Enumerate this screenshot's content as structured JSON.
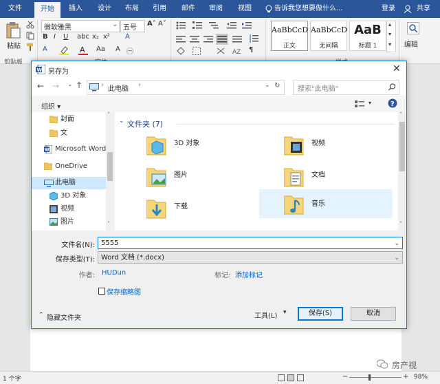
{
  "ribbon": {
    "tabs": [
      "文件",
      "开始",
      "插入",
      "设计",
      "布局",
      "引用",
      "邮件",
      "审阅",
      "视图"
    ],
    "active_tab": "开始",
    "tell_me": "告诉我您想要做什么...",
    "login": "登录",
    "share": "共享",
    "clipboard": {
      "paste": "粘贴",
      "group": "剪贴板"
    },
    "font": {
      "name": "微软雅黑",
      "size": "五号",
      "group": "字体"
    },
    "styles": {
      "items": [
        {
          "preview": "AaBbCcD",
          "name": "正文"
        },
        {
          "preview": "AaBbCcD",
          "name": "无间隔"
        },
        {
          "preview": "AaB",
          "name": "标题 1"
        }
      ],
      "group": "样式"
    },
    "edit": {
      "label": "编辑"
    }
  },
  "dialog": {
    "title": "另存为",
    "breadcrumb": "此电脑",
    "search_placeholder": "搜索\"此电脑\"",
    "organize": "组织 ▾",
    "nav_items": [
      {
        "label": "封面",
        "icon": "folder-icon"
      },
      {
        "label": "文",
        "icon": "folder-icon"
      },
      {
        "label": "Microsoft Word",
        "icon": "word-icon"
      },
      {
        "label": "OneDrive",
        "icon": "folder-icon"
      },
      {
        "label": "此电脑",
        "icon": "computer-icon"
      },
      {
        "label": "3D 对象",
        "icon": "3d-objects-icon"
      },
      {
        "label": "视频",
        "icon": "video-icon"
      },
      {
        "label": "图片",
        "icon": "pictures-icon"
      }
    ],
    "section_header": "文件夹 (7)",
    "folders": [
      {
        "label": "3D 对象",
        "icon": "3d-objects-icon"
      },
      {
        "label": "视频",
        "icon": "video-folder-icon"
      },
      {
        "label": "图片",
        "icon": "pictures-folder-icon"
      },
      {
        "label": "文档",
        "icon": "documents-folder-icon"
      },
      {
        "label": "下载",
        "icon": "downloads-folder-icon"
      },
      {
        "label": "音乐",
        "icon": "music-folder-icon"
      }
    ],
    "filename_label": "文件名(N):",
    "filename_value": "5555",
    "filetype_label": "保存类型(T):",
    "filetype_value": "Word 文档 (*.docx)",
    "author_label": "作者:",
    "author_value": "HUDun",
    "tags_label": "标记:",
    "tags_value": "添加标记",
    "thumbnail_label": "保存缩略图",
    "hide_folders": "隐藏文件夹",
    "tools": "工具(L)",
    "save": "保存(S)",
    "cancel": "取消"
  },
  "status": {
    "page_info": "1 个字",
    "zoom": "98%",
    "watermark": "房产视"
  }
}
